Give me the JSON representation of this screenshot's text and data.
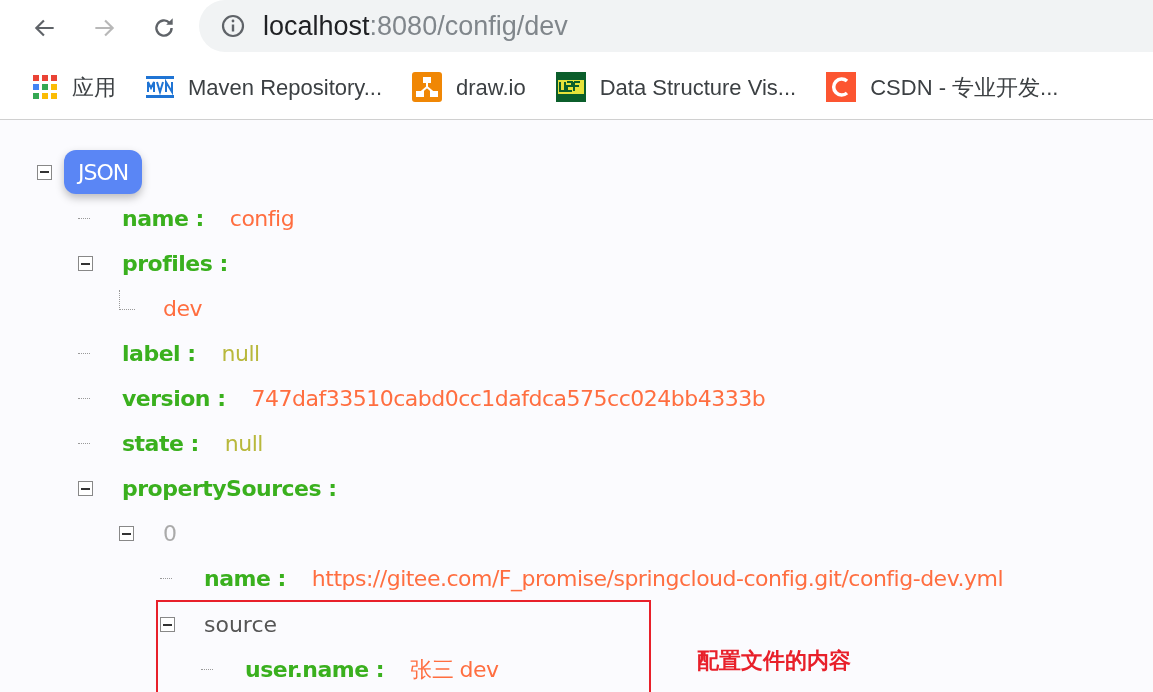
{
  "browser": {
    "url_host": "localhost",
    "url_path": ":8080/config/dev",
    "bookmarks": [
      {
        "kind": "apps",
        "label": "应用"
      },
      {
        "kind": "mvn",
        "label": "Maven Repository..."
      },
      {
        "kind": "drawio",
        "label": "draw.io"
      },
      {
        "kind": "usf",
        "label": "Data Structure Vis..."
      },
      {
        "kind": "csdn",
        "label": "CSDN - 专业开发..."
      }
    ]
  },
  "tree": {
    "label": "JSON",
    "expanded": true,
    "children": [
      {
        "kind": "pair",
        "key": "name :",
        "value": "config",
        "color": "#ff6e40"
      },
      {
        "kind": "branch",
        "key": "profiles :",
        "expanded": true,
        "children": [
          {
            "kind": "item",
            "value": "dev",
            "color": "#ff6e40"
          }
        ]
      },
      {
        "kind": "pair",
        "key": "label :",
        "value": "null",
        "color": "#b8b83c"
      },
      {
        "kind": "pair",
        "key": "version :",
        "value": "747daf33510cabd0cc1dafdca575cc024bb4333b",
        "color": "#ff6e40"
      },
      {
        "kind": "pair",
        "key": "state :",
        "value": "null",
        "color": "#b8b83c"
      },
      {
        "kind": "branch",
        "key": "propertySources :",
        "expanded": true,
        "children": [
          {
            "kind": "index",
            "key": "0",
            "expanded": true,
            "children": [
              {
                "kind": "pair",
                "key": "name :",
                "value": "https://gitee.com/F_promise/springcloud-config.git/config-dev.yml",
                "color": "#ff6e40"
              },
              {
                "kind": "object",
                "key": "source",
                "expanded": true,
                "highlighted": true,
                "children": [
                  {
                    "kind": "pair",
                    "key": "user.name :",
                    "value": "张三 dev",
                    "color": "#ff6e40"
                  }
                ]
              }
            ]
          }
        ]
      }
    ]
  },
  "annotation": "配置文件的内容"
}
